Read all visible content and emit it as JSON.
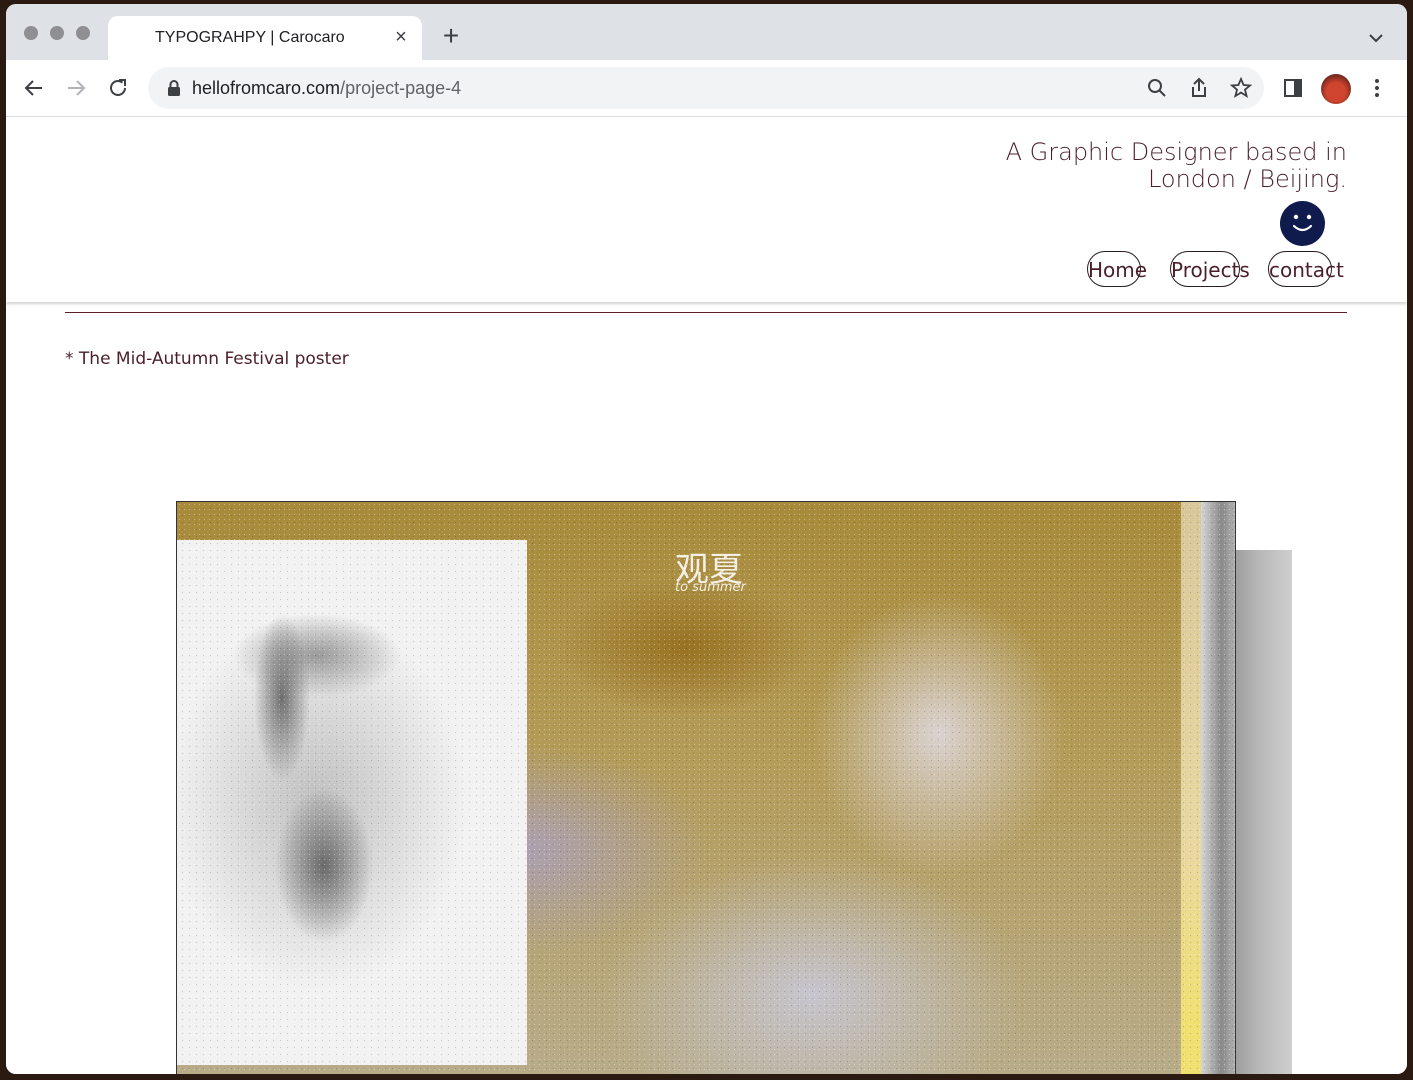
{
  "browser": {
    "tab_title": "TYPOGRAHPY | Carocaro",
    "tab_close": "×",
    "new_tab": "+",
    "url_domain": "hellofromcaro.com",
    "url_path": "/project-page-4"
  },
  "site": {
    "tagline_line1": "A Graphic Designer based in",
    "tagline_line2": "London / Beijing.",
    "nav": {
      "home": "Home",
      "projects": "Projects",
      "contact": "contact"
    }
  },
  "content": {
    "caption": "* The Mid-Autumn Festival poster",
    "poster_title": "观夏",
    "poster_subtitle": "to summer"
  },
  "colors": {
    "text_accent": "#4a1f2b",
    "smiley": "#0f1b4d"
  }
}
